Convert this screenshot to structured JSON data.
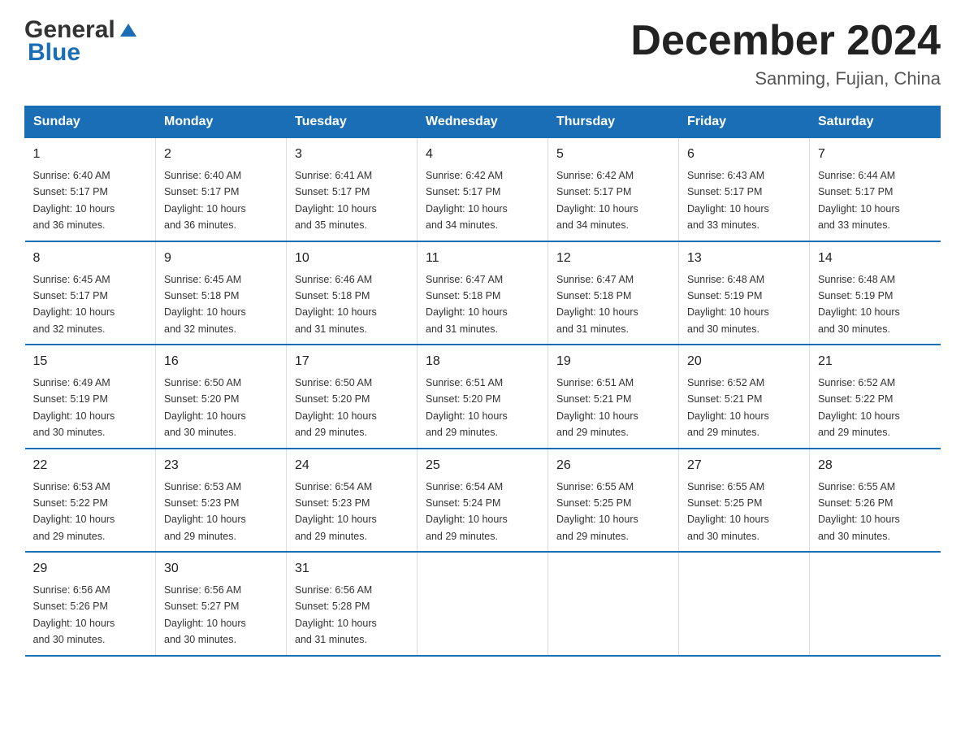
{
  "header": {
    "logo_general": "General",
    "logo_blue": "Blue",
    "calendar_title": "December 2024",
    "subtitle": "Sanming, Fujian, China"
  },
  "weekdays": [
    "Sunday",
    "Monday",
    "Tuesday",
    "Wednesday",
    "Thursday",
    "Friday",
    "Saturday"
  ],
  "weeks": [
    [
      {
        "day": "1",
        "sunrise": "6:40 AM",
        "sunset": "5:17 PM",
        "daylight": "10 hours and 36 minutes."
      },
      {
        "day": "2",
        "sunrise": "6:40 AM",
        "sunset": "5:17 PM",
        "daylight": "10 hours and 36 minutes."
      },
      {
        "day": "3",
        "sunrise": "6:41 AM",
        "sunset": "5:17 PM",
        "daylight": "10 hours and 35 minutes."
      },
      {
        "day": "4",
        "sunrise": "6:42 AM",
        "sunset": "5:17 PM",
        "daylight": "10 hours and 34 minutes."
      },
      {
        "day": "5",
        "sunrise": "6:42 AM",
        "sunset": "5:17 PM",
        "daylight": "10 hours and 34 minutes."
      },
      {
        "day": "6",
        "sunrise": "6:43 AM",
        "sunset": "5:17 PM",
        "daylight": "10 hours and 33 minutes."
      },
      {
        "day": "7",
        "sunrise": "6:44 AM",
        "sunset": "5:17 PM",
        "daylight": "10 hours and 33 minutes."
      }
    ],
    [
      {
        "day": "8",
        "sunrise": "6:45 AM",
        "sunset": "5:17 PM",
        "daylight": "10 hours and 32 minutes."
      },
      {
        "day": "9",
        "sunrise": "6:45 AM",
        "sunset": "5:18 PM",
        "daylight": "10 hours and 32 minutes."
      },
      {
        "day": "10",
        "sunrise": "6:46 AM",
        "sunset": "5:18 PM",
        "daylight": "10 hours and 31 minutes."
      },
      {
        "day": "11",
        "sunrise": "6:47 AM",
        "sunset": "5:18 PM",
        "daylight": "10 hours and 31 minutes."
      },
      {
        "day": "12",
        "sunrise": "6:47 AM",
        "sunset": "5:18 PM",
        "daylight": "10 hours and 31 minutes."
      },
      {
        "day": "13",
        "sunrise": "6:48 AM",
        "sunset": "5:19 PM",
        "daylight": "10 hours and 30 minutes."
      },
      {
        "day": "14",
        "sunrise": "6:48 AM",
        "sunset": "5:19 PM",
        "daylight": "10 hours and 30 minutes."
      }
    ],
    [
      {
        "day": "15",
        "sunrise": "6:49 AM",
        "sunset": "5:19 PM",
        "daylight": "10 hours and 30 minutes."
      },
      {
        "day": "16",
        "sunrise": "6:50 AM",
        "sunset": "5:20 PM",
        "daylight": "10 hours and 30 minutes."
      },
      {
        "day": "17",
        "sunrise": "6:50 AM",
        "sunset": "5:20 PM",
        "daylight": "10 hours and 29 minutes."
      },
      {
        "day": "18",
        "sunrise": "6:51 AM",
        "sunset": "5:20 PM",
        "daylight": "10 hours and 29 minutes."
      },
      {
        "day": "19",
        "sunrise": "6:51 AM",
        "sunset": "5:21 PM",
        "daylight": "10 hours and 29 minutes."
      },
      {
        "day": "20",
        "sunrise": "6:52 AM",
        "sunset": "5:21 PM",
        "daylight": "10 hours and 29 minutes."
      },
      {
        "day": "21",
        "sunrise": "6:52 AM",
        "sunset": "5:22 PM",
        "daylight": "10 hours and 29 minutes."
      }
    ],
    [
      {
        "day": "22",
        "sunrise": "6:53 AM",
        "sunset": "5:22 PM",
        "daylight": "10 hours and 29 minutes."
      },
      {
        "day": "23",
        "sunrise": "6:53 AM",
        "sunset": "5:23 PM",
        "daylight": "10 hours and 29 minutes."
      },
      {
        "day": "24",
        "sunrise": "6:54 AM",
        "sunset": "5:23 PM",
        "daylight": "10 hours and 29 minutes."
      },
      {
        "day": "25",
        "sunrise": "6:54 AM",
        "sunset": "5:24 PM",
        "daylight": "10 hours and 29 minutes."
      },
      {
        "day": "26",
        "sunrise": "6:55 AM",
        "sunset": "5:25 PM",
        "daylight": "10 hours and 29 minutes."
      },
      {
        "day": "27",
        "sunrise": "6:55 AM",
        "sunset": "5:25 PM",
        "daylight": "10 hours and 30 minutes."
      },
      {
        "day": "28",
        "sunrise": "6:55 AM",
        "sunset": "5:26 PM",
        "daylight": "10 hours and 30 minutes."
      }
    ],
    [
      {
        "day": "29",
        "sunrise": "6:56 AM",
        "sunset": "5:26 PM",
        "daylight": "10 hours and 30 minutes."
      },
      {
        "day": "30",
        "sunrise": "6:56 AM",
        "sunset": "5:27 PM",
        "daylight": "10 hours and 30 minutes."
      },
      {
        "day": "31",
        "sunrise": "6:56 AM",
        "sunset": "5:28 PM",
        "daylight": "10 hours and 31 minutes."
      },
      null,
      null,
      null,
      null
    ]
  ],
  "cell_labels": {
    "sunrise": "Sunrise:",
    "sunset": "Sunset:",
    "daylight": "Daylight:"
  }
}
